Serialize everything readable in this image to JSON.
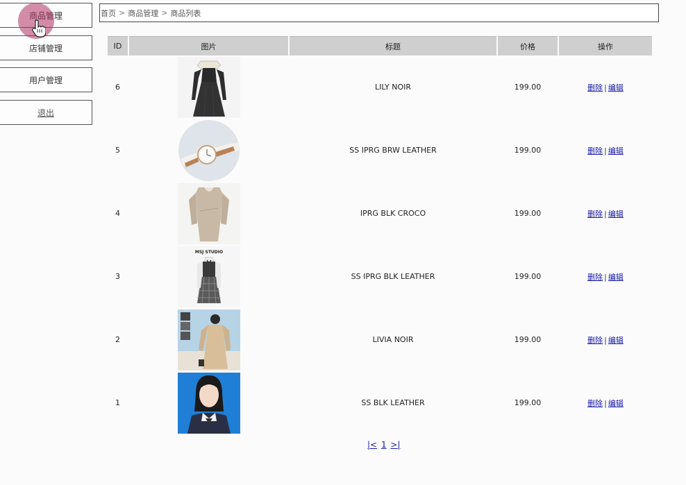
{
  "sidebar": {
    "items": [
      {
        "label": "商品管理"
      },
      {
        "label": "店铺管理"
      },
      {
        "label": "用户管理"
      },
      {
        "label": "退出"
      }
    ]
  },
  "breadcrumb": {
    "home": "首页",
    "section": "商品管理",
    "current": "商品列表",
    "separator": ">"
  },
  "table": {
    "headers": {
      "id": "ID",
      "image": "图片",
      "title": "标题",
      "price": "价格",
      "actions": "操作"
    },
    "rows": [
      {
        "id": "6",
        "title": "LILY NOIR",
        "price": "199.00",
        "image": "black-dress-photo"
      },
      {
        "id": "5",
        "title": "SS IPRG BRW LEATHER",
        "price": "199.00",
        "image": "watch-photo"
      },
      {
        "id": "4",
        "title": "IPRG BLK CROCO",
        "price": "199.00",
        "image": "beige-top-photo"
      },
      {
        "id": "3",
        "title": "SS IPRG BLK LEATHER",
        "price": "199.00",
        "image": "plaid-dress-photo",
        "image_caption": "MSJ STUDIO"
      },
      {
        "id": "2",
        "title": "LIVIA NOIR",
        "price": "199.00",
        "image": "trench-coat-photo"
      },
      {
        "id": "1",
        "title": "SS BLK LEATHER",
        "price": "199.00",
        "image": "portrait-photo"
      }
    ],
    "action_delete": "删除",
    "action_edit": "编辑",
    "action_separator": "|"
  },
  "pager": {
    "first": "|<",
    "page": "1",
    "last": ">|"
  },
  "colors": {
    "link": "#1a1aa8",
    "header_bg": "#cfcfcf",
    "cursor_highlight": "#b03060"
  }
}
